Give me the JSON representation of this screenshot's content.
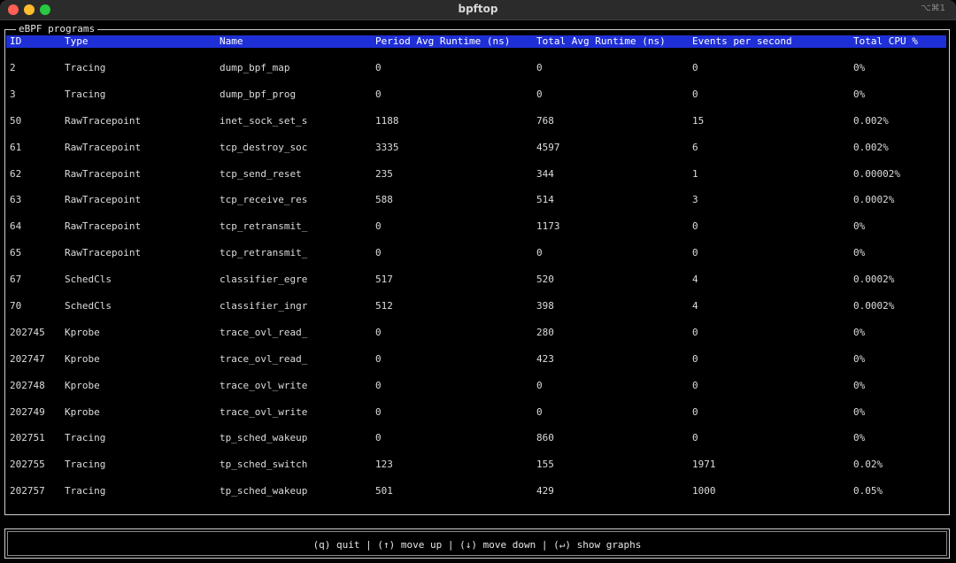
{
  "window": {
    "title": "bpftop",
    "shortcut": "⌥⌘1"
  },
  "panel": {
    "title": "eBPF programs"
  },
  "table": {
    "columns": [
      "ID",
      "Type",
      "Name",
      "Period Avg Runtime (ns)",
      "Total Avg Runtime (ns)",
      "Events per second",
      "Total CPU %"
    ],
    "rows": [
      [
        "2",
        "Tracing",
        "dump_bpf_map",
        "0",
        "0",
        "0",
        "0%"
      ],
      [
        "3",
        "Tracing",
        "dump_bpf_prog",
        "0",
        "0",
        "0",
        "0%"
      ],
      [
        "50",
        "RawTracepoint",
        "inet_sock_set_s",
        "1188",
        "768",
        "15",
        "0.002%"
      ],
      [
        "61",
        "RawTracepoint",
        "tcp_destroy_soc",
        "3335",
        "4597",
        "6",
        "0.002%"
      ],
      [
        "62",
        "RawTracepoint",
        "tcp_send_reset",
        "235",
        "344",
        "1",
        "0.00002%"
      ],
      [
        "63",
        "RawTracepoint",
        "tcp_receive_res",
        "588",
        "514",
        "3",
        "0.0002%"
      ],
      [
        "64",
        "RawTracepoint",
        "tcp_retransmit_",
        "0",
        "1173",
        "0",
        "0%"
      ],
      [
        "65",
        "RawTracepoint",
        "tcp_retransmit_",
        "0",
        "0",
        "0",
        "0%"
      ],
      [
        "67",
        "SchedCls",
        "classifier_egre",
        "517",
        "520",
        "4",
        "0.0002%"
      ],
      [
        "70",
        "SchedCls",
        "classifier_ingr",
        "512",
        "398",
        "4",
        "0.0002%"
      ],
      [
        "202745",
        "Kprobe",
        "trace_ovl_read_",
        "0",
        "280",
        "0",
        "0%"
      ],
      [
        "202747",
        "Kprobe",
        "trace_ovl_read_",
        "0",
        "423",
        "0",
        "0%"
      ],
      [
        "202748",
        "Kprobe",
        "trace_ovl_write",
        "0",
        "0",
        "0",
        "0%"
      ],
      [
        "202749",
        "Kprobe",
        "trace_ovl_write",
        "0",
        "0",
        "0",
        "0%"
      ],
      [
        "202751",
        "Tracing",
        "tp_sched_wakeup",
        "0",
        "860",
        "0",
        "0%"
      ],
      [
        "202755",
        "Tracing",
        "tp_sched_switch",
        "123",
        "155",
        "1971",
        "0.02%"
      ],
      [
        "202757",
        "Tracing",
        "tp_sched_wakeup",
        "501",
        "429",
        "1000",
        "0.05%"
      ]
    ]
  },
  "footer": {
    "help": "(q) quit | (↑) move up | (↓) move down | (↵) show graphs"
  },
  "colors": {
    "header_bg": "#1f2fd6",
    "background": "#000000",
    "text": "#dcdcdc"
  }
}
